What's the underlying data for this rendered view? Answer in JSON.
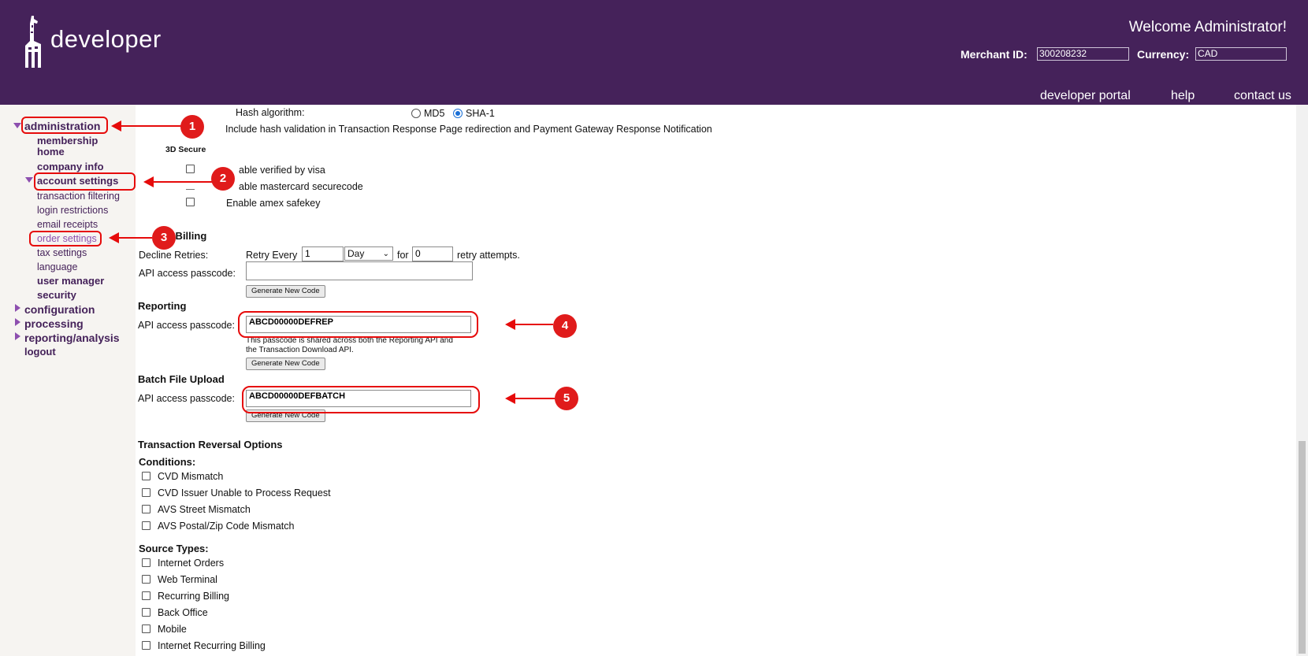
{
  "header": {
    "logo_text": "developer",
    "welcome": "Welcome Administrator!",
    "merchant_id_label": "Merchant ID:",
    "merchant_id_value": "300208232",
    "currency_label": "Currency:",
    "currency_value": "CAD",
    "links": [
      "developer portal",
      "help",
      "contact us"
    ]
  },
  "sidebar": {
    "administration": "administration",
    "membership_home": "membership home",
    "company_info": "company info",
    "account_settings": "account settings",
    "transaction_filtering": "transaction filtering",
    "login_restrictions": "login restrictions",
    "email_receipts": "email receipts",
    "order_settings": "order settings",
    "tax_settings": "tax settings",
    "language": "language",
    "user_manager": "user manager",
    "security": "security",
    "configuration": "configuration",
    "processing": "processing",
    "reporting_analysis": "reporting/analysis",
    "logout": "logout"
  },
  "hash": {
    "label": "Hash algorithm:",
    "option_md5": "MD5",
    "option_sha1": "SHA-1",
    "selected": "SHA-1",
    "include_text": "Include hash validation in Transaction Response Page redirection and Payment Gateway Response Notification"
  },
  "secure3d": {
    "title": "3D Secure",
    "visa": "able verified by visa",
    "mastercard": "able mastercard securecode",
    "amex": "Enable amex safekey"
  },
  "recurring": {
    "title": "g Billing",
    "decline_label": "Decline Retries:",
    "retry_every": "Retry Every",
    "retry_value": "1",
    "period": "Day",
    "for_label": "for",
    "attempts_value": "0",
    "retry_attempts": "retry attempts.",
    "passcode_label": "API access passcode:",
    "passcode_value": "",
    "generate_button": "Generate New Code"
  },
  "reporting": {
    "title": "Reporting",
    "passcode_label": "API access passcode:",
    "passcode_value": "ABCD00000DEFREP",
    "note_line1": "This passcode is shared across both the Reporting API and",
    "note_line2": "the Transaction Download API.",
    "generate_button": "Generate New Code"
  },
  "batch": {
    "title": "Batch File Upload",
    "passcode_label": "API access passcode:",
    "passcode_value": "ABCD00000DEFBATCH",
    "generate_button": "Generate New Code"
  },
  "reversal": {
    "title": "Transaction Reversal Options",
    "conditions_label": "Conditions:",
    "conditions": [
      "CVD Mismatch",
      "CVD Issuer Unable to Process Request",
      "AVS Street Mismatch",
      "AVS Postal/Zip Code Mismatch"
    ],
    "source_types_label": "Source Types:",
    "source_types": [
      "Internet Orders",
      "Web Terminal",
      "Recurring Billing",
      "Back Office",
      "Mobile",
      "Internet Recurring Billing"
    ]
  },
  "annotations": [
    "1",
    "2",
    "3",
    "4",
    "5"
  ],
  "colors": {
    "header_bg": "#45225a",
    "nav_text": "#45225a",
    "accent": "#8d4faf",
    "annotation_red": "#e60b0b"
  }
}
